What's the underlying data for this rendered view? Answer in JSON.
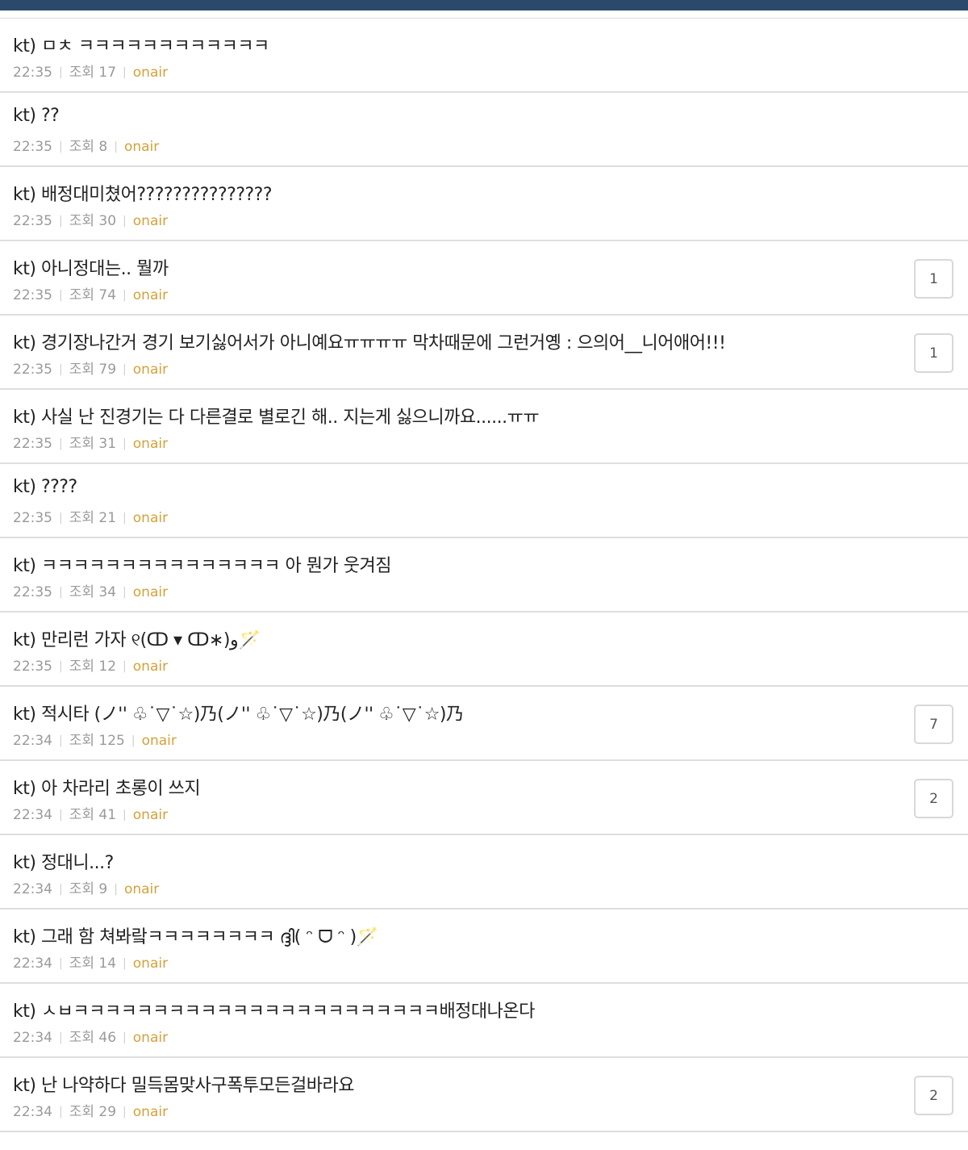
{
  "posts": [
    {
      "title": "kt) ㅁㅊ ㅋㅋㅋㅋㅋㅋㅋㅋㅋㅋㅋㅋ",
      "time": "22:35",
      "views": "조회 17",
      "tag": "onair",
      "comments": ""
    },
    {
      "title": "kt) ??",
      "time": "22:35",
      "views": "조회 8",
      "tag": "onair",
      "comments": ""
    },
    {
      "title": "kt) 배정대미쳤어???????????????",
      "time": "22:35",
      "views": "조회 30",
      "tag": "onair",
      "comments": ""
    },
    {
      "title": "kt) 아니정대는.. 뭘까",
      "time": "22:35",
      "views": "조회 74",
      "tag": "onair",
      "comments": "1"
    },
    {
      "title": "kt) 경기장나간거 경기 보기싫어서가 아니예요ㅠㅠㅠㅠ 막차때문에 그런거옝 : 으의어__니어애어!!!",
      "time": "22:35",
      "views": "조회 79",
      "tag": "onair",
      "comments": "1"
    },
    {
      "title": "kt) 사실 난 진경기는 다 다른결로 별로긴 해.. 지는게 싫으니까요......ㅠㅠ",
      "time": "22:35",
      "views": "조회 31",
      "tag": "onair",
      "comments": ""
    },
    {
      "title": "kt) ????",
      "time": "22:35",
      "views": "조회 21",
      "tag": "onair",
      "comments": ""
    },
    {
      "title": "kt) ㅋㅋㅋㅋㅋㅋㅋㅋㅋㅋㅋㅋㅋㅋㅋ 아 뭔가 웃겨짐",
      "time": "22:35",
      "views": "조회 34",
      "tag": "onair",
      "comments": ""
    },
    {
      "title": "kt) 만리런 가자 ୧(ↀ ▾ ↀ∗)و🪄",
      "time": "22:35",
      "views": "조회 12",
      "tag": "onair",
      "comments": ""
    },
    {
      "title": "kt) 적시타 (ノ'' ♧˙▽˙☆)乃(ノ'' ♧˙▽˙☆)乃(ノ'' ♧˙▽˙☆)乃",
      "time": "22:34",
      "views": "조회 125",
      "tag": "onair",
      "comments": "7"
    },
    {
      "title": "kt) 아 차라리 초롱이 쓰지",
      "time": "22:34",
      "views": "조회 41",
      "tag": "onair",
      "comments": "2"
    },
    {
      "title": "kt) 정대니...?",
      "time": "22:34",
      "views": "조회 9",
      "tag": "onair",
      "comments": ""
    },
    {
      "title": "kt) 그래 함 쳐봐랔ㅋㅋㅋㅋㅋㅋㅋㅋ ദ്ദി( ᵔ ᗜ ᵔ )🪄",
      "time": "22:34",
      "views": "조회 14",
      "tag": "onair",
      "comments": ""
    },
    {
      "title": "kt) ㅅㅂㅋㅋㅋㅋㅋㅋㅋㅋㅋㅋㅋㅋㅋㅋㅋㅋㅋㅋㅋㅋㅋㅋㅋ배정대나온다",
      "time": "22:34",
      "views": "조회 46",
      "tag": "onair",
      "comments": ""
    },
    {
      "title": "kt) 난 나약하다 밀득몸맞사구폭투모든걸바라요",
      "time": "22:34",
      "views": "조회 29",
      "tag": "onair",
      "comments": "2"
    }
  ]
}
